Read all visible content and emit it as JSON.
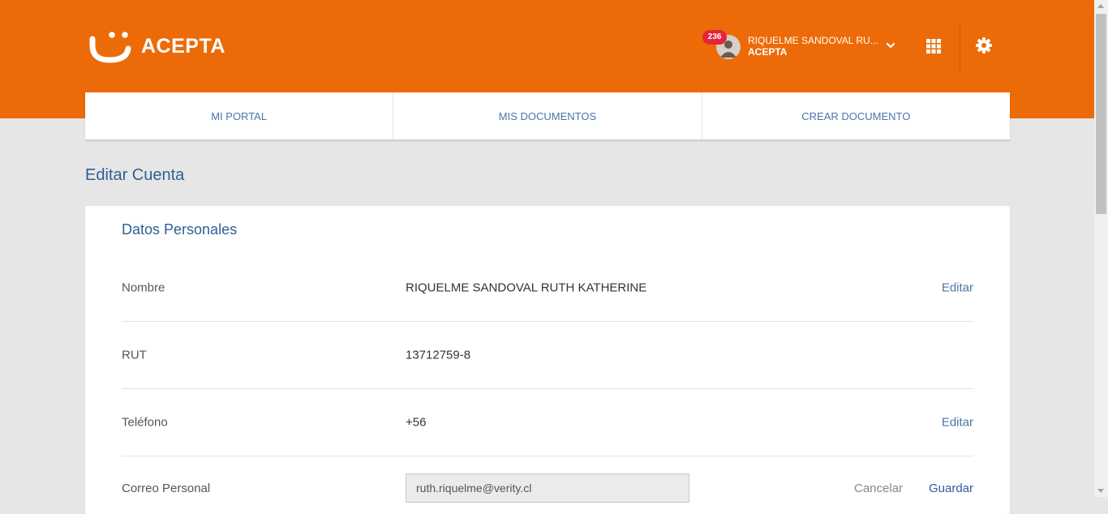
{
  "header": {
    "brand": "ACEPTA",
    "notifications_count": "236",
    "user_name": "RIQUELME SANDOVAL RU...",
    "user_org": "ACEPTA",
    "brand_color": "#ec6b08"
  },
  "nav": {
    "tabs": [
      {
        "label": "MI PORTAL"
      },
      {
        "label": "MIS DOCUMENTOS"
      },
      {
        "label": "CREAR DOCUMENTO"
      }
    ]
  },
  "page": {
    "title": "Editar Cuenta"
  },
  "card": {
    "title": "Datos Personales",
    "rows": [
      {
        "label": "Nombre",
        "value": "RIQUELME SANDOVAL RUTH KATHERINE",
        "action": "Editar"
      },
      {
        "label": "RUT",
        "value": "13712759-8"
      },
      {
        "label": "Teléfono",
        "value": "+56",
        "action": "Editar"
      }
    ],
    "email_row": {
      "label": "Correo Personal",
      "input_value": "ruth.riquelme@verity.cl",
      "cancel_label": "Cancelar",
      "save_label": "Guardar"
    }
  },
  "icons": {
    "logo": "acepta-smile-logo-icon",
    "avatar": "user-avatar-icon",
    "dropdown": "chevron-down-icon",
    "apps": "apps-grid-icon",
    "settings": "gear-icon"
  }
}
